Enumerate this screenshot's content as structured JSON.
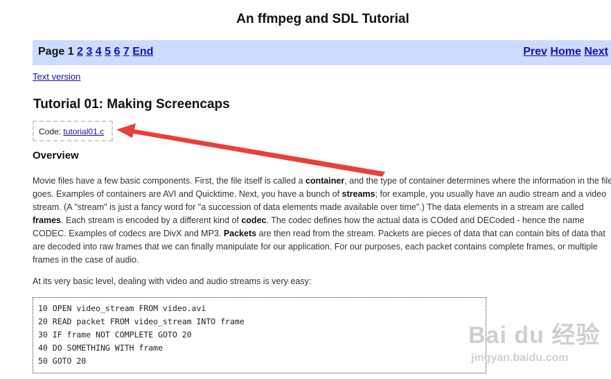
{
  "header": {
    "title": "An ffmpeg and SDL Tutorial"
  },
  "nav": {
    "page_label": "Page 1",
    "pages": [
      "2",
      "3",
      "4",
      "5",
      "6",
      "7"
    ],
    "end_label": "End",
    "prev_label": "Prev",
    "home_label": "Home",
    "next_label": "Next"
  },
  "text_version_label": "Text version",
  "tutorial": {
    "title": "Tutorial 01: Making Screencaps",
    "code_label": "Code:",
    "code_file": "tutorial01.c",
    "overview_heading": "Overview",
    "paragraph": {
      "t1": "Movie files have a few basic components. First, the file itself is called a ",
      "b1": "container",
      "t2": ", and the type of container determines where the information in the file goes. Examples of containers are AVI and Quicktime. Next, you have a bunch of ",
      "b2": "streams",
      "t3": "; for example, you usually have an audio stream and a video stream. (A \"stream\" is just a fancy word for \"a succession of data elements made available over time\".) The data elements in a stream are called ",
      "b3": "frames",
      "t4": ". Each stream is encoded by a different kind of ",
      "b4": "codec",
      "t5": ". The codec defines how the actual data is COded and DECoded - hence the name CODEC. Examples of codecs are DivX and MP3. ",
      "b5": "Packets",
      "t6": " are then read from the stream. Packets are pieces of data that can contain bits of data that are decoded into raw frames that we can finally manipulate for our application. For our purposes, each packet contains complete frames, or multiple frames in the case of audio."
    },
    "intro_line": "At its very basic level, dealing with video and audio streams is very easy:",
    "code_lines": [
      "10 OPEN video_stream FROM video.avi",
      "20 READ packet FROM video_stream INTO frame",
      "30 IF frame NOT COMPLETE GOTO 20",
      "40 DO SOMETHING WITH frame",
      "50 GOTO 20"
    ]
  },
  "watermark": {
    "logo_text": "Bai du 经验",
    "url": "jingyan.baidu.com"
  },
  "colors": {
    "nav_background": "#ccdcff",
    "link": "#1a0dab",
    "annotation_arrow": "#e8413a"
  }
}
